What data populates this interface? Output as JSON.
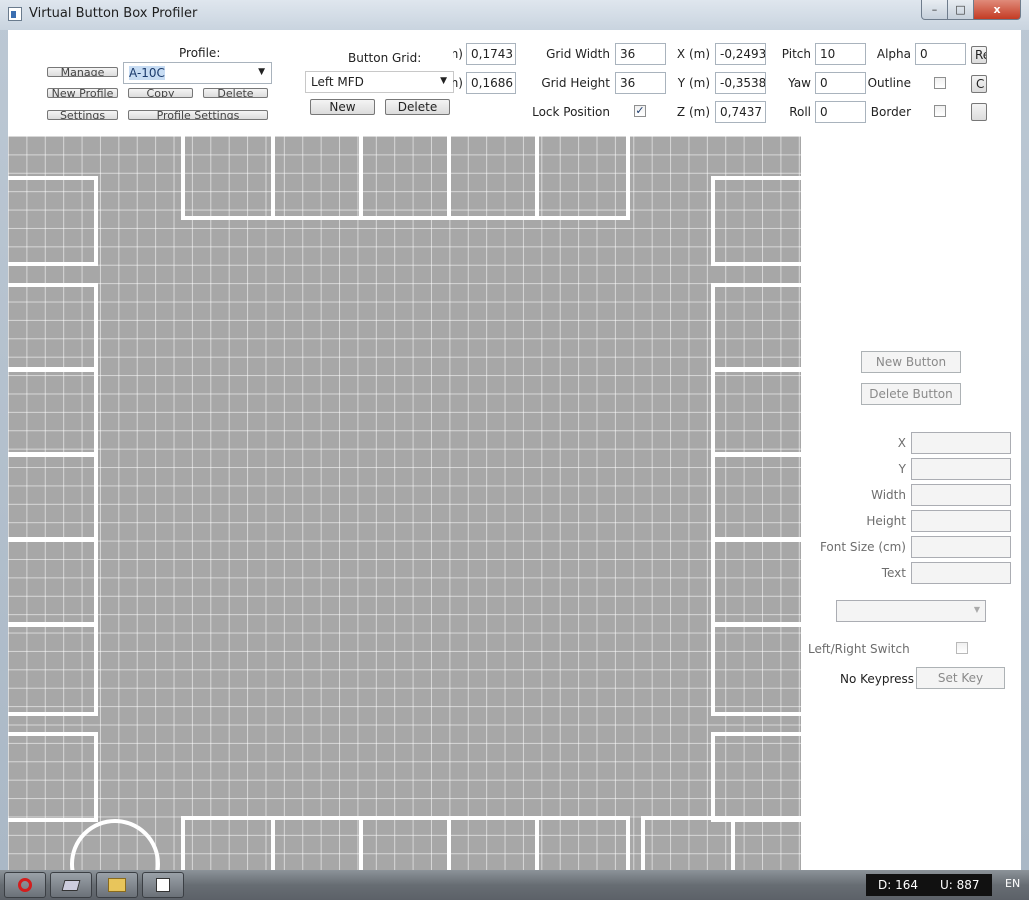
{
  "window": {
    "title": "Virtual Button Box Profiler",
    "min": "–",
    "max": "□",
    "close": "x"
  },
  "profile": {
    "label": "Profile:",
    "selected": "A-10C",
    "buttons": [
      "Manage Hotkeys",
      "New Profile",
      "Copy",
      "Delete",
      "Settings",
      "Profile Settings"
    ]
  },
  "button_grid": {
    "label": "Button Grid:",
    "selected": "Left MFD",
    "new": "New",
    "delete": "Delete"
  },
  "size": {
    "w_label": "h (m)",
    "w_value": "0,1743",
    "h_label": "h (m)",
    "h_value": "0,1686"
  },
  "grid_fields": {
    "grid_width_label": "Grid Width",
    "grid_width": "36",
    "grid_height_label": "Grid Height",
    "grid_height": "36",
    "lock_label": "Lock Position",
    "lock_checked": "✓"
  },
  "position": {
    "x_label": "X (m)",
    "x": "-0,2493",
    "y_label": "Y (m)",
    "y": "-0,3538",
    "z_label": "Z (m)",
    "z": "0,7437"
  },
  "rotation": {
    "pitch_label": "Pitch",
    "pitch": "10",
    "yaw_label": "Yaw",
    "yaw": "0",
    "roll_label": "Roll",
    "roll": "0"
  },
  "appearance": {
    "alpha_label": "Alpha",
    "alpha": "0",
    "outline_label": "Outline",
    "border_label": "Border",
    "reset_btn": "Re",
    "color_btn": "C"
  },
  "button_panel": {
    "new_button": "New Button",
    "delete_button": "Delete Button",
    "fields": [
      "X",
      "Y",
      "Width",
      "Height",
      "Font Size (cm)",
      "Text"
    ],
    "switch_label": "Left/Right Switch",
    "keypress_label": "No Keypress",
    "set_key": "Set Key"
  },
  "taskbar": {
    "tray_d": "D: 164",
    "tray_u": "U: 887",
    "lang": "EN"
  }
}
